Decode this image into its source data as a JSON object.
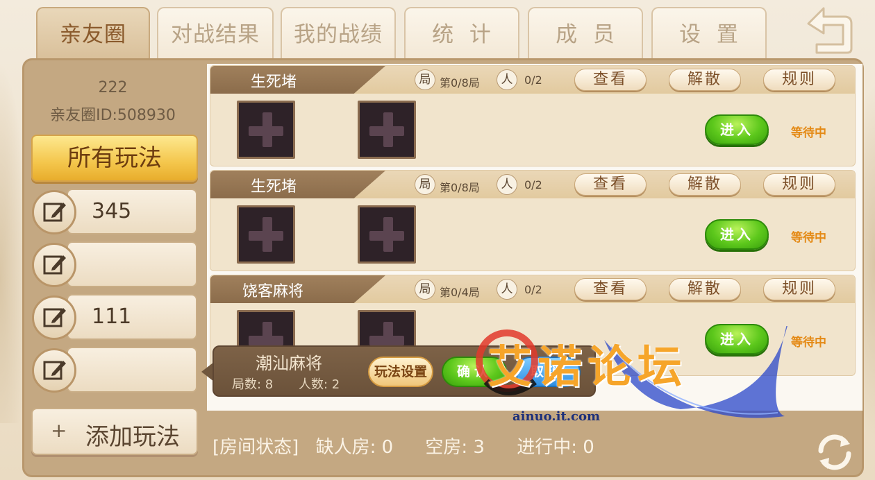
{
  "tabs": [
    {
      "label": "亲友圈",
      "active": true
    },
    {
      "label": "对战结果",
      "active": false
    },
    {
      "label": "我的战绩",
      "active": false
    },
    {
      "label": "统  计",
      "active": false
    },
    {
      "label": "成  员",
      "active": false
    },
    {
      "label": "设  置",
      "active": false
    }
  ],
  "back_icon": "back-arrow-icon",
  "circle": {
    "name": "222",
    "id": "亲友圈ID:508930"
  },
  "sidebar": {
    "all_modes": "所有玩法",
    "modes": [
      {
        "label": "345"
      },
      {
        "label": ""
      },
      {
        "label": "111"
      },
      {
        "label": ""
      }
    ],
    "add_mode_plus": "+",
    "add_mode": "添加玩法"
  },
  "rooms": [
    {
      "name": "生死堵",
      "round_icon": "局",
      "round": "第0/8局",
      "people_icon": "人",
      "people": "0/2",
      "view": "查看",
      "dismiss": "解散",
      "rules": "规则",
      "enter": "进入",
      "status": "等待中"
    },
    {
      "name": "生死堵",
      "round_icon": "局",
      "round": "第0/8局",
      "people_icon": "人",
      "people": "0/2",
      "view": "查看",
      "dismiss": "解散",
      "rules": "规则",
      "enter": "进入",
      "status": "等待中"
    },
    {
      "name": "饶客麻将",
      "round_icon": "局",
      "round": "第0/4局",
      "people_icon": "人",
      "people": "0/2",
      "view": "查看",
      "dismiss": "解散",
      "rules": "规则",
      "enter": "进入",
      "status": "等待中"
    }
  ],
  "popup": {
    "title": "潮汕麻将",
    "rounds": "局数: 8",
    "players": "人数: 2",
    "setting": "玩法设置",
    "confirm": "确认",
    "cancel": "取消"
  },
  "status_bar": {
    "label": "[房间状态]",
    "short": "缺人房: 0",
    "empty": "空房: 3",
    "playing": "进行中: 0"
  },
  "watermark": {
    "text": "艾诺论坛",
    "url": "ainuo.it.com"
  },
  "colors": {
    "accent_gold": "#f4c64c",
    "enter_green": "#5dc81c",
    "waiting_orange": "#e48a16",
    "panel": "#c4a882"
  }
}
